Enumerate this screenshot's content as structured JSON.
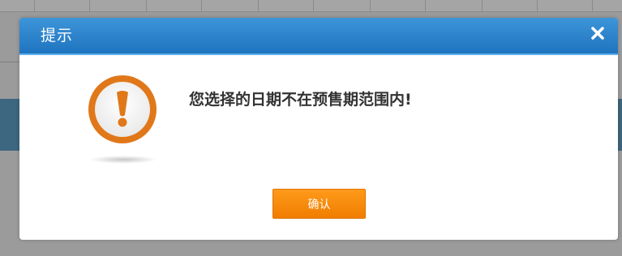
{
  "dialog": {
    "title": "提示",
    "message": "您选择的日期不在预售期范围内!",
    "confirm_label": "确认",
    "icons": {
      "close": "close-icon",
      "alert": "exclamation-circle-icon"
    },
    "colors": {
      "header": "#2a84cd",
      "confirm_button": "#f98a0b",
      "alert_icon": "#e0781a"
    }
  }
}
